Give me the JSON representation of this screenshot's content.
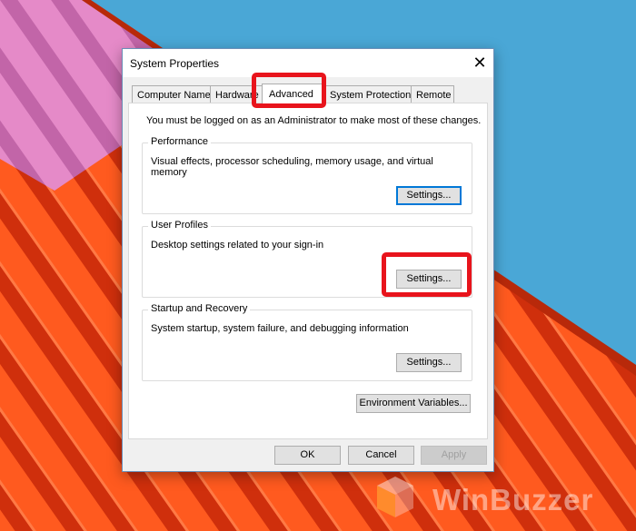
{
  "dialog": {
    "title": "System Properties",
    "close_glyph": "✕"
  },
  "tabs": [
    {
      "label": "Computer Name"
    },
    {
      "label": "Hardware"
    },
    {
      "label": "Advanced"
    },
    {
      "label": "System Protection"
    },
    {
      "label": "Remote"
    }
  ],
  "advanced": {
    "admin_message": "You must be logged on as an Administrator to make most of these changes.",
    "performance": {
      "label": "Performance",
      "description": "Visual effects, processor scheduling, memory usage, and virtual memory",
      "button": "Settings..."
    },
    "user_profiles": {
      "label": "User Profiles",
      "description": "Desktop settings related to your sign-in",
      "button": "Settings..."
    },
    "startup_recovery": {
      "label": "Startup and Recovery",
      "description": "System startup, system failure, and debugging information",
      "button": "Settings..."
    },
    "env_button": "Environment Variables..."
  },
  "footer": {
    "ok": "OK",
    "cancel": "Cancel",
    "apply": "Apply"
  },
  "watermark": {
    "text": "WinBuzzer"
  },
  "colors": {
    "highlight": "#e8141c",
    "sky": "#4aa7d6",
    "roof_orange": "#ff5a1f",
    "roof_pink": "#e58ac8",
    "focus_blue": "#0078d7"
  },
  "icons": {
    "close": "close-icon",
    "watermark_logo": "winbuzzer-logo-icon"
  }
}
